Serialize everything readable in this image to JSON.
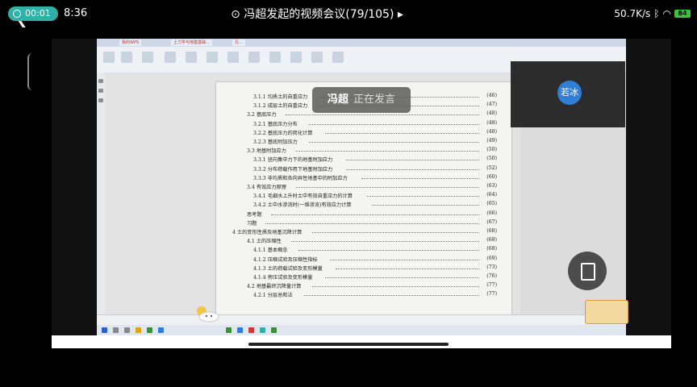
{
  "phone_status": {
    "record_timer": "00:01",
    "clock": "8:36",
    "net_speed": "50.7K/s",
    "battery": "84"
  },
  "meeting": {
    "title": "冯超发起的视频会议(79/105)",
    "speaker_name": "冯超",
    "speaker_status": "正在发言",
    "participant_avatar": "若冰"
  },
  "shared_doc": {
    "tabs": [
      "我的WPS",
      "土力学与地基基础...",
      "孔..."
    ],
    "toc": [
      {
        "num": "3.1.1",
        "text": "均质土的自重应力",
        "page": "(46)",
        "level": 3
      },
      {
        "num": "3.1.2",
        "text": "成层土的自重应力",
        "page": "(47)",
        "level": 3
      },
      {
        "num": "3.2",
        "text": "基底压力",
        "page": "(48)",
        "level": 2
      },
      {
        "num": "3.2.1",
        "text": "基底压力分布",
        "page": "(48)",
        "level": 3
      },
      {
        "num": "3.2.2",
        "text": "基底压力的简化计算",
        "page": "(48)",
        "level": 3
      },
      {
        "num": "3.2.3",
        "text": "基底附加压力",
        "page": "(49)",
        "level": 3
      },
      {
        "num": "3.3",
        "text": "地基附加应力",
        "page": "(50)",
        "level": 2
      },
      {
        "num": "3.3.1",
        "text": "竖向集中力下的地基附加应力",
        "page": "(50)",
        "level": 3
      },
      {
        "num": "3.3.2",
        "text": "分布荷载作用下地基附加应力",
        "page": "(52)",
        "level": 3
      },
      {
        "num": "3.3.3",
        "text": "非均质和各向异性地基中的附加应力",
        "page": "(60)",
        "level": 3
      },
      {
        "num": "3.4",
        "text": "有效应力原理",
        "page": "(63)",
        "level": 2
      },
      {
        "num": "3.4.1",
        "text": "毛细水上升时土中有效自重应力的计算",
        "page": "(64)",
        "level": 3
      },
      {
        "num": "3.4.2",
        "text": "土中水渗流时(一维渗流)有效应力计算",
        "page": "(65)",
        "level": 3
      },
      {
        "num": "",
        "text": "思考题",
        "page": "(66)",
        "level": 1
      },
      {
        "num": "",
        "text": "习题",
        "page": "(67)",
        "level": 1
      },
      {
        "num": "4",
        "text": "土的变形性质及地基沉降计算",
        "page": "(68)",
        "level": 0
      },
      {
        "num": "4.1",
        "text": "土的压缩性",
        "page": "(68)",
        "level": 2
      },
      {
        "num": "4.1.1",
        "text": "基本概念",
        "page": "(68)",
        "level": 3
      },
      {
        "num": "4.1.2",
        "text": "压缩试验及压缩性指标",
        "page": "(69)",
        "level": 3
      },
      {
        "num": "4.1.3",
        "text": "土的荷载试验及变形模量",
        "page": "(73)",
        "level": 3
      },
      {
        "num": "4.1.4",
        "text": "旁压试验及变形模量",
        "page": "(76)",
        "level": 3
      },
      {
        "num": "4.2",
        "text": "地基最终沉降量计算",
        "page": "(77)",
        "level": 2
      },
      {
        "num": "4.2.1",
        "text": "分层总和法",
        "page": "(77)",
        "level": 3
      }
    ]
  }
}
